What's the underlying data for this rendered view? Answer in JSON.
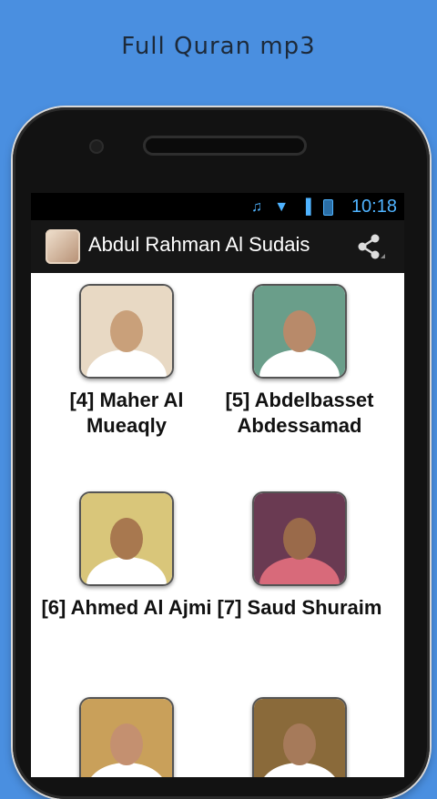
{
  "promo": {
    "title": "Full Quran mp3"
  },
  "status_bar": {
    "time": "10:18"
  },
  "action_bar": {
    "title": "Abdul Rahman Al Sudais",
    "share_icon": "share-icon"
  },
  "reciters": [
    {
      "label": "[4] Maher Al Mueaqly",
      "bg": "#e8d9c4",
      "face": "#c9a07a",
      "cloth": "#ffffff"
    },
    {
      "label": "[5] Abdelbasset Abdessamad",
      "bg": "#6a9e8a",
      "face": "#b88a6a",
      "cloth": "#ffffff"
    },
    {
      "label": "[6] Ahmed Al Ajmi",
      "bg": "#d9c67a",
      "face": "#a8784f",
      "cloth": "#ffffff"
    },
    {
      "label": "[7] Saud Shuraim",
      "bg": "#6a3a52",
      "face": "#9a6a4a",
      "cloth": "#d86a7a"
    },
    {
      "label": "",
      "bg": "#c9a05a",
      "face": "#c49070",
      "cloth": "#ffffff"
    },
    {
      "label": "",
      "bg": "#8a6a3a",
      "face": "#a67a5a",
      "cloth": "#ffffff"
    }
  ]
}
